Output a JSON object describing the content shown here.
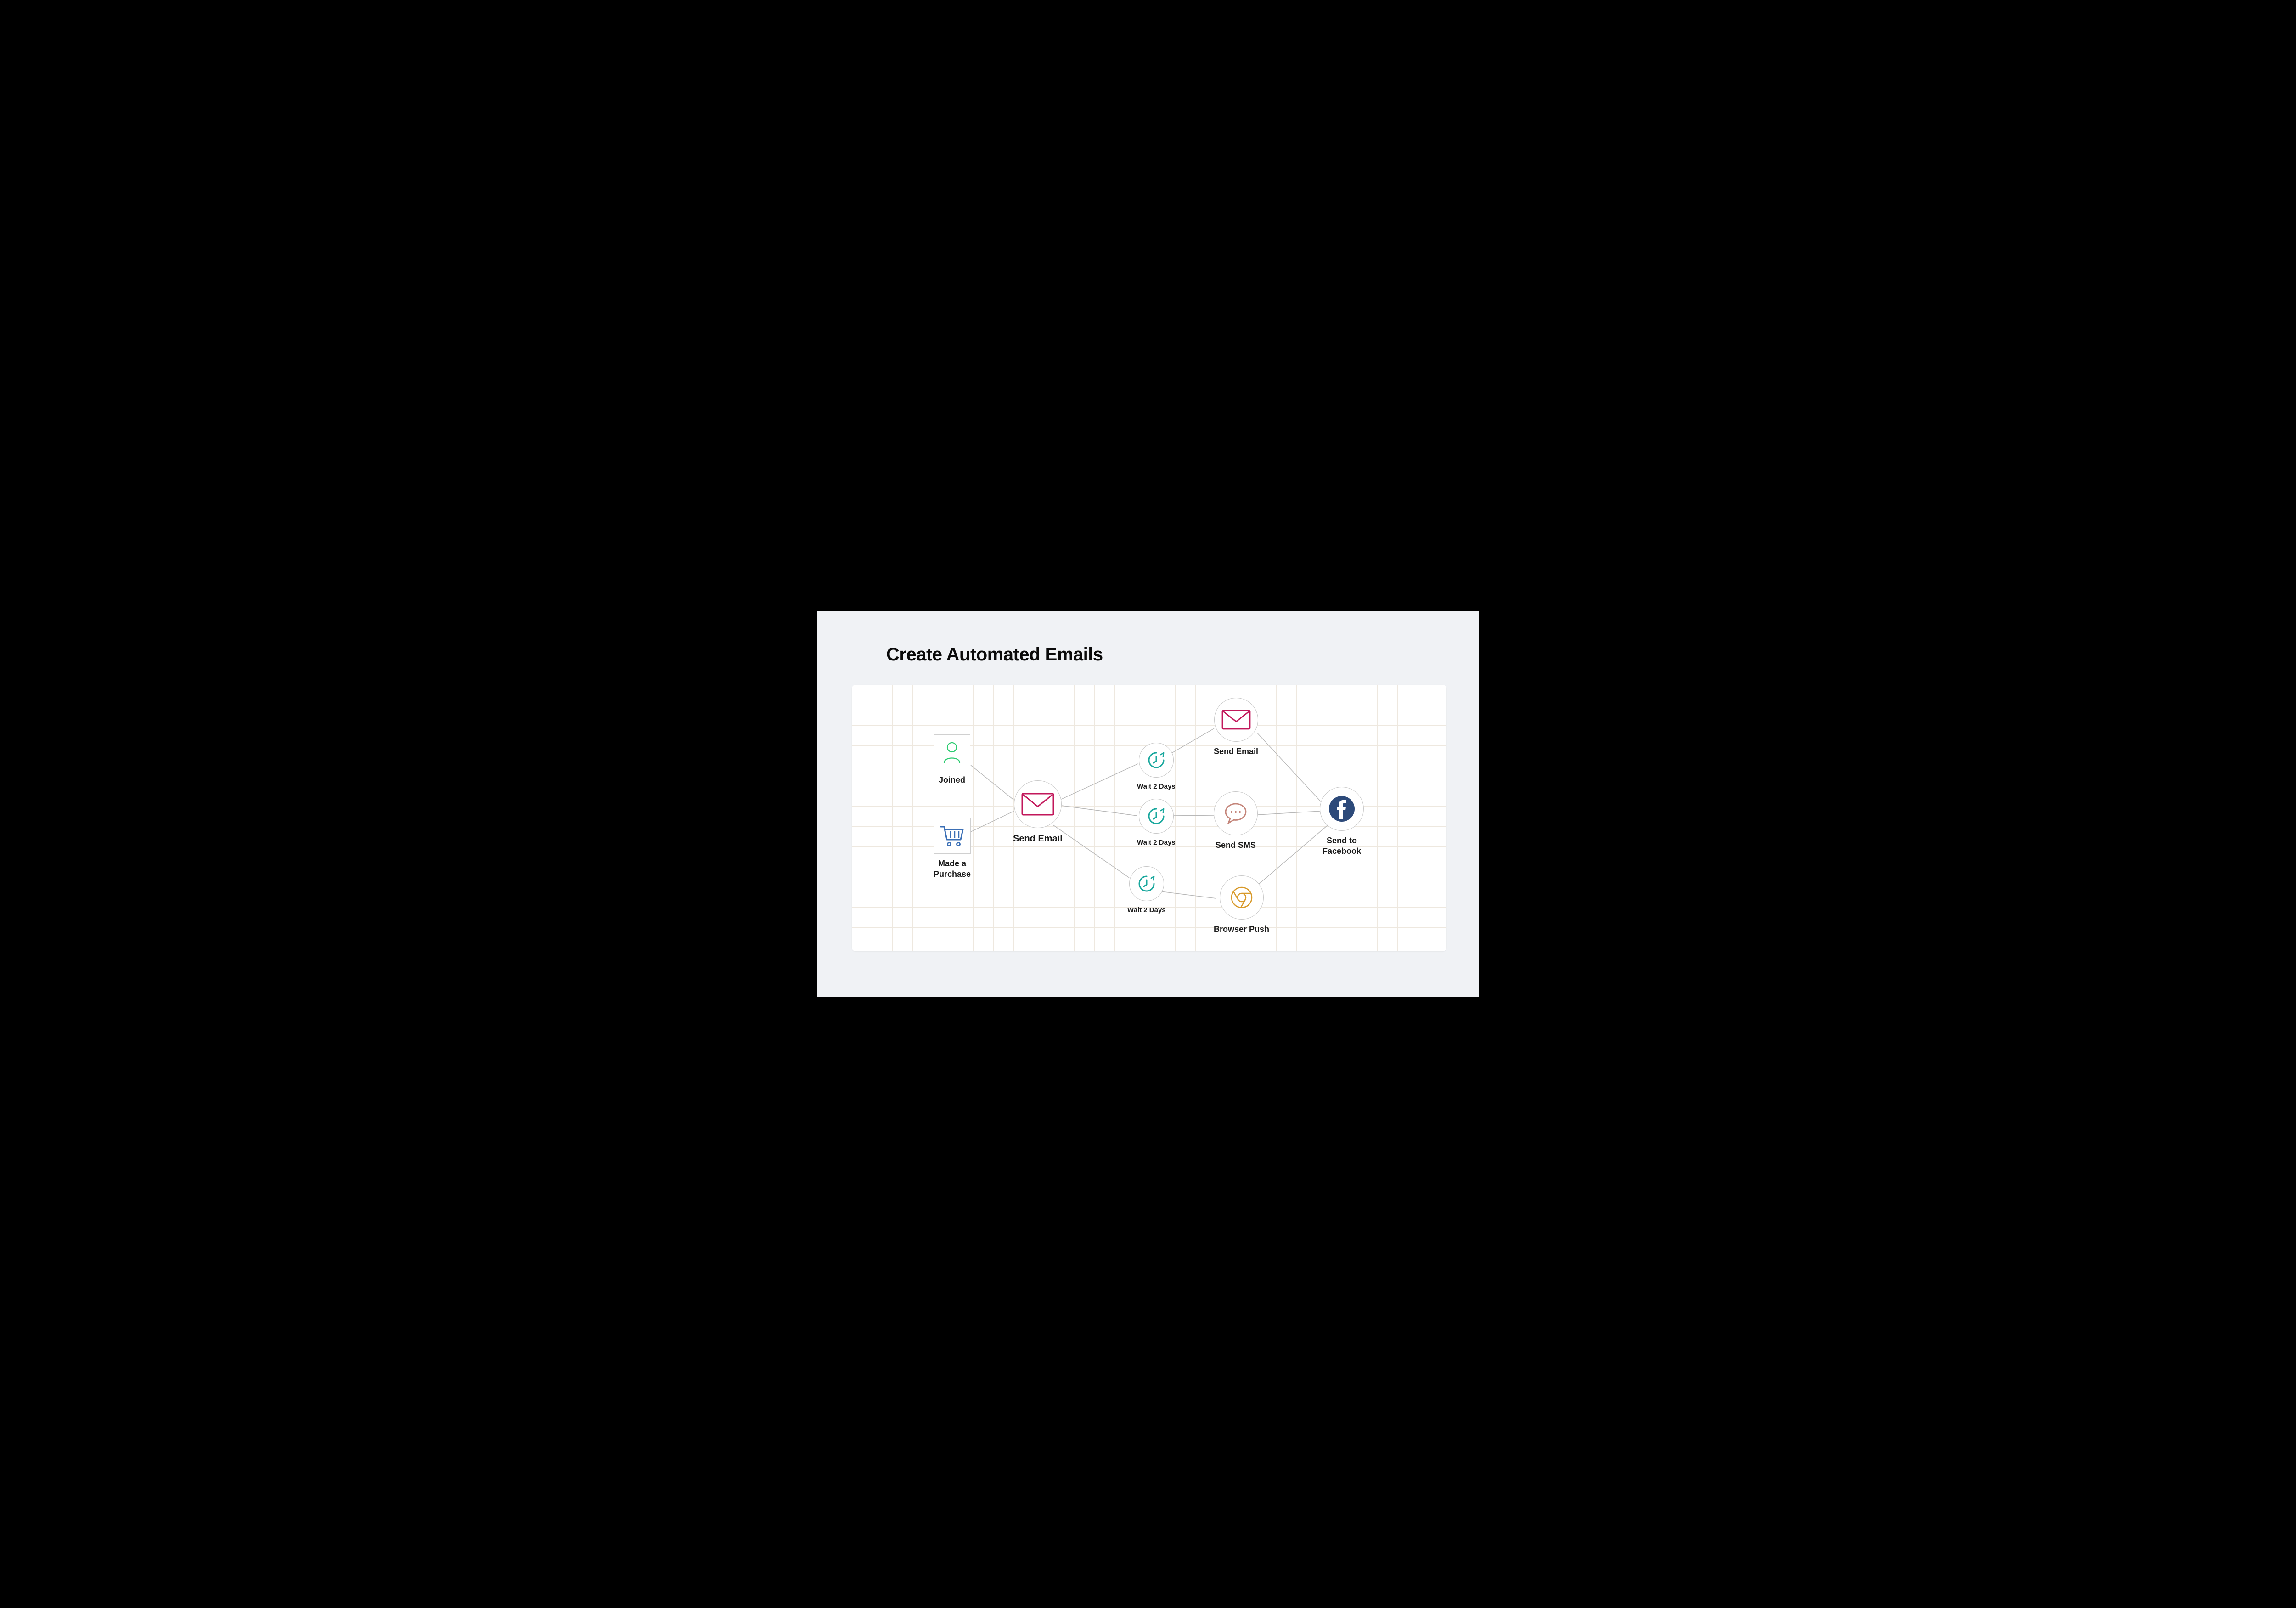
{
  "title": "Create Automated Emails",
  "nodes": {
    "joined": {
      "label": "Joined"
    },
    "purchase": {
      "label": "Made a\nPurchase"
    },
    "sendEmail1": {
      "label": "Send Email"
    },
    "wait1": {
      "label": "Wait 2 Days"
    },
    "wait2": {
      "label": "Wait 2 Days"
    },
    "wait3": {
      "label": "Wait 2 Days"
    },
    "sendEmail2": {
      "label": "Send Email"
    },
    "sendSMS": {
      "label": "Send SMS"
    },
    "browserPush": {
      "label": "Browser Push"
    },
    "sendFacebook": {
      "label": "Send to\nFacebook"
    }
  },
  "colors": {
    "person": "#2ecc71",
    "cart": "#3b6fb5",
    "envelope": "#c2185b",
    "clock": "#1aa89e",
    "sms": "#c4857a",
    "chrome": "#d89a2b",
    "facebook": "#2d4a7a"
  }
}
